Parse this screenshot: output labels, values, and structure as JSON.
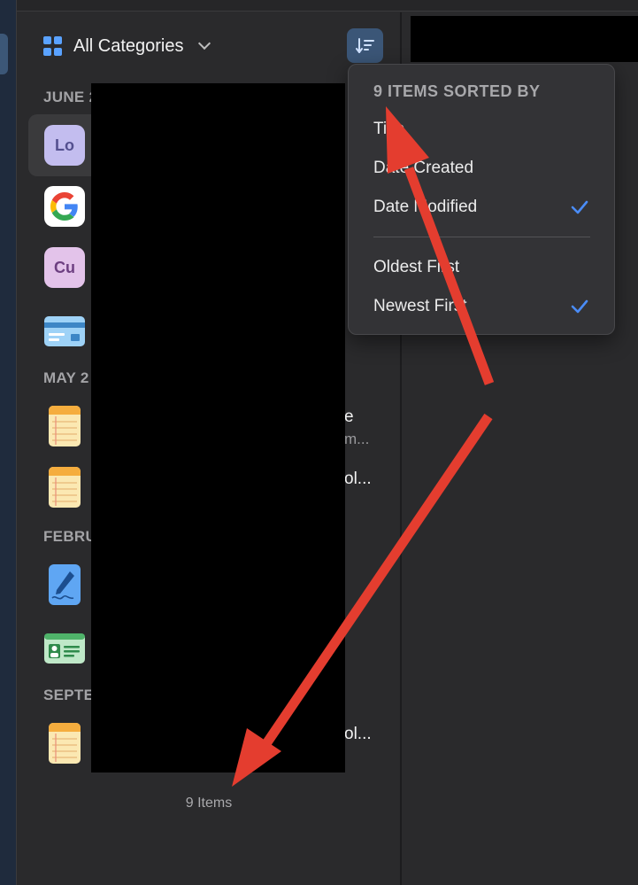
{
  "header": {
    "category_label": "All Categories"
  },
  "sections": [
    {
      "label": "JUNE 2"
    },
    {
      "label": "MAY 2"
    },
    {
      "label": "FEBRU"
    },
    {
      "label": "SEPTE"
    }
  ],
  "items": [
    {
      "icon_text": "Lo",
      "icon": "lo-avatar-icon"
    },
    {
      "icon_text": "",
      "icon": "google-icon"
    },
    {
      "icon_text": "Cu",
      "icon": "cu-avatar-icon"
    },
    {
      "icon_text": "",
      "icon": "credit-card-icon"
    },
    {
      "icon_text": "",
      "icon": "note-icon",
      "partial_title": "e",
      "partial_sub": "m..."
    },
    {
      "icon_text": "",
      "icon": "note-icon",
      "partial_title": "ol..."
    },
    {
      "icon_text": "",
      "icon": "signature-pen-icon"
    },
    {
      "icon_text": "",
      "icon": "id-card-icon"
    },
    {
      "icon_text": "",
      "icon": "note-icon",
      "partial_title": "ol..."
    }
  ],
  "footer": {
    "items_count": "9 Items"
  },
  "sort_menu": {
    "title": "9 ITEMS SORTED BY",
    "sort_by_options": [
      {
        "label": "Title",
        "checked": false
      },
      {
        "label": "Date Created",
        "checked": false
      },
      {
        "label": "Date Modified",
        "checked": true
      }
    ],
    "order_options": [
      {
        "label": "Oldest First",
        "checked": false
      },
      {
        "label": "Newest First",
        "checked": true
      }
    ]
  },
  "colors": {
    "accent": "#5aa2ff",
    "sort_button_bg": "#3b5677",
    "check_color": "#4a8cf7",
    "annotation_arrow": "#e43d2f"
  }
}
